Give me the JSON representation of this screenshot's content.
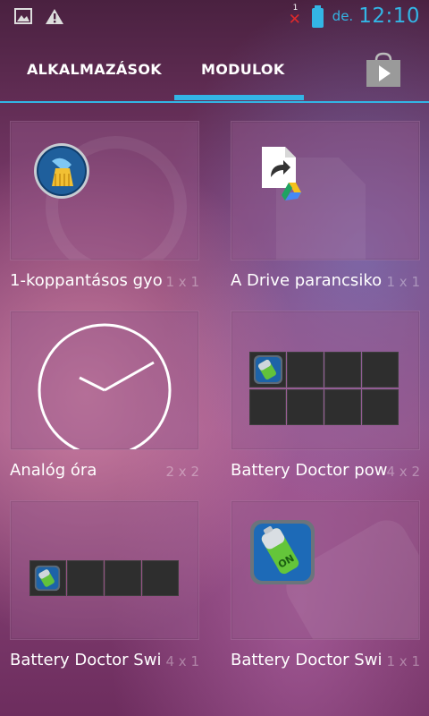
{
  "status_bar": {
    "icons_left": [
      "picture-icon",
      "warning-icon"
    ],
    "signal_badge": "1",
    "ampm": "de.",
    "time": "12:10",
    "accent_color": "#33b5e5"
  },
  "tabs": {
    "apps_label": "ALKALMAZÁSOK",
    "widgets_label": "MODULOK",
    "active": "MODULOK"
  },
  "widgets": [
    {
      "label": "1-koppantásos gyo",
      "size": "1 x 1",
      "icon": "broom-cleaner-icon"
    },
    {
      "label": "A Drive parancsiko",
      "size": "1 x 1",
      "icon": "drive-shortcut-icon"
    },
    {
      "label": "Analóg óra",
      "size": "2 x 2",
      "icon": "analog-clock-icon"
    },
    {
      "label": "Battery Doctor pow",
      "size": "4 x 2",
      "icon": "battery-doctor-icon"
    },
    {
      "label": "Battery Doctor Swi",
      "size": "4 x 1",
      "icon": "battery-doctor-icon"
    },
    {
      "label": "Battery Doctor Swi",
      "size": "1 x 1",
      "icon": "battery-switch-on-icon"
    }
  ]
}
